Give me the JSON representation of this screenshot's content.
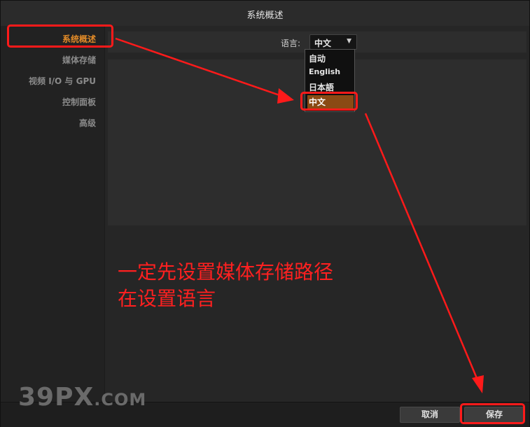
{
  "window": {
    "title": "系统概述"
  },
  "sidebar": {
    "items": [
      {
        "label": "系统概述",
        "active": true
      },
      {
        "label": "媒体存储"
      },
      {
        "label": "视频 I/O 与 GPU"
      },
      {
        "label": "控制面板"
      },
      {
        "label": "高级"
      }
    ]
  },
  "language": {
    "label": "语言:",
    "selected": "中文",
    "options": [
      "自动",
      "English",
      "日本語",
      "中文"
    ]
  },
  "annotation": {
    "line1": "一定先设置媒体存储路径",
    "line2": "在设置语言"
  },
  "footer": {
    "cancel_label": "取消",
    "save_label": "保存"
  },
  "watermark": {
    "main": "39PX",
    "suffix": ".COM"
  },
  "colors": {
    "accent": "#e08a28",
    "highlight": "#ff1a1a",
    "selection": "#8a4a14"
  }
}
